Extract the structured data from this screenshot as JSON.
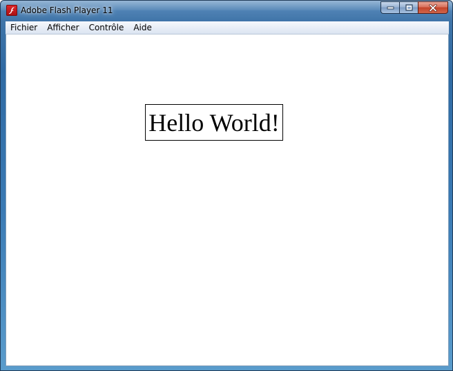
{
  "window": {
    "title": "Adobe Flash Player 11",
    "icon": "flash-player-icon"
  },
  "caption_buttons": {
    "minimize_icon": "minimize-icon",
    "maximize_icon": "maximize-icon",
    "close_icon": "close-icon"
  },
  "menubar": {
    "items": [
      {
        "label": "Fichier"
      },
      {
        "label": "Afficher"
      },
      {
        "label": "Contrôle"
      },
      {
        "label": "Aide"
      }
    ]
  },
  "stage": {
    "text": "Hello World!"
  },
  "colors": {
    "flash_icon_red": "#d0181c",
    "close_button": "#c4432a",
    "frame_blue": "#3f74a8"
  }
}
